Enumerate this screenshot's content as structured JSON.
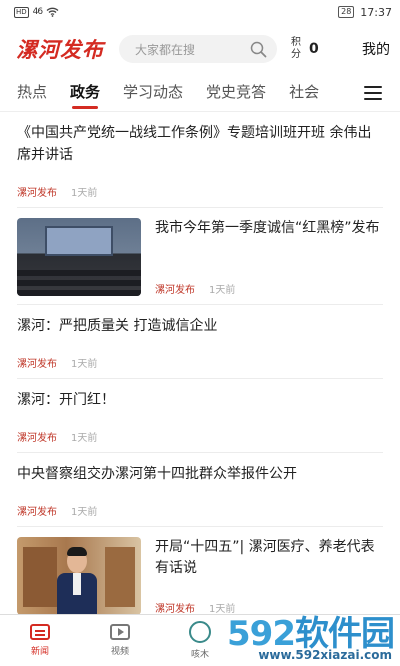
{
  "status_bar": {
    "hd": "HD",
    "signal": "46",
    "battery": "28",
    "time": "17:37"
  },
  "header": {
    "logo": "漯河发布",
    "search_placeholder": "大家都在搜",
    "score_label": "积分",
    "score_value": "0",
    "mine_label": "我的"
  },
  "tabs": [
    {
      "label": "热点"
    },
    {
      "label": "政务",
      "active": true
    },
    {
      "label": "学习动态"
    },
    {
      "label": "党史竞答"
    },
    {
      "label": "社会"
    }
  ],
  "feed": [
    {
      "title": "《中国共产党统一战线工作条例》专题培训班开班 余伟出席并讲话",
      "source": "漯河发布",
      "time": "1天前"
    },
    {
      "title": "我市今年第一季度诚信“红黑榜”发布",
      "source": "漯河发布",
      "time": "1天前",
      "image": "meeting-photo"
    },
    {
      "title": "漯河：严把质量关 打造诚信企业",
      "source": "漯河发布",
      "time": "1天前"
    },
    {
      "title": "漯河：开门红！",
      "source": "漯河发布",
      "time": "1天前"
    },
    {
      "title": "中央督察组交办漯河第十四批群众举报件公开",
      "source": "漯河发布",
      "time": "1天前"
    },
    {
      "title": "开局“十四五”| 漯河医疗、养老代表有话说",
      "source": "漯河发布",
      "time": "1天前",
      "image": "portrait-photo"
    }
  ],
  "bottom_nav": [
    {
      "label": "新闻",
      "icon": "news-icon",
      "active": true
    },
    {
      "label": "视频",
      "icon": "video-icon"
    },
    {
      "label": "咳木",
      "icon": "chat-icon"
    }
  ],
  "watermark": {
    "brand_num": "592",
    "brand_cn": "软件园",
    "url": "www.592xiazai.com"
  },
  "colors": {
    "accent": "#d42b22",
    "source": "#c0392b",
    "watermark": "#2d8fcc"
  }
}
